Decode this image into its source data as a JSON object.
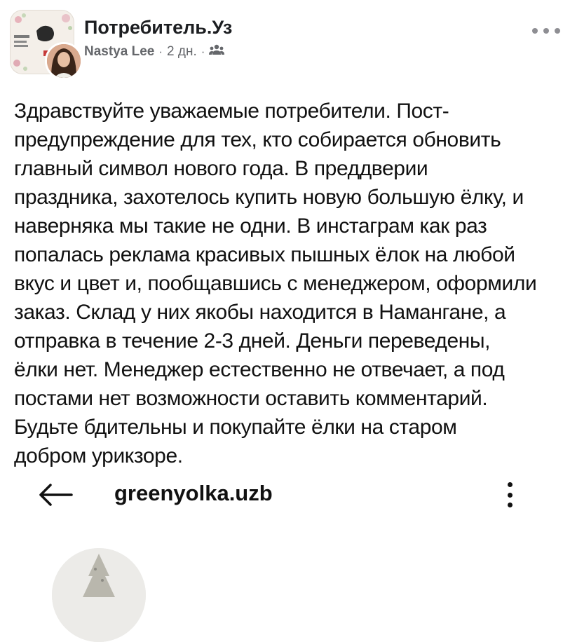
{
  "post": {
    "group_name": "Потребитель.Уз",
    "author": "Nastya Lee",
    "time": "2 дн.",
    "separator": "·",
    "audience_icon": "group-icon",
    "more_icon": "more-horizontal-icon",
    "body": "Здравствуйте уважаемые потребители. Пост-\nпредупреждение для тех, кто собирается обновить\nглавный символ нового года. В преддверии\nпраздника, захотелось купить новую большую ёлку, и\nнаверняка мы такие не одни. В инстаграм как раз\nпопалась реклама красивых пышных ёлок на любой\nвкус и цвет и, пообщавшись с менеджером, оформили\nзаказ. Склад у них якобы находится в Намангане, а\nотправка в течение 2-3 дней. Деньги переведены,\nёлки нет. Менеджер естественно не отвечает, а под\nпостами нет возможности оставить комментарий.\nБудьте бдительны и покупайте ёлки на старом\nдобром урикзоре."
  },
  "embedded_screenshot": {
    "back_icon": "arrow-left-icon",
    "title": "greenyolka.uzb",
    "menu_icon": "more-vertical-icon"
  }
}
